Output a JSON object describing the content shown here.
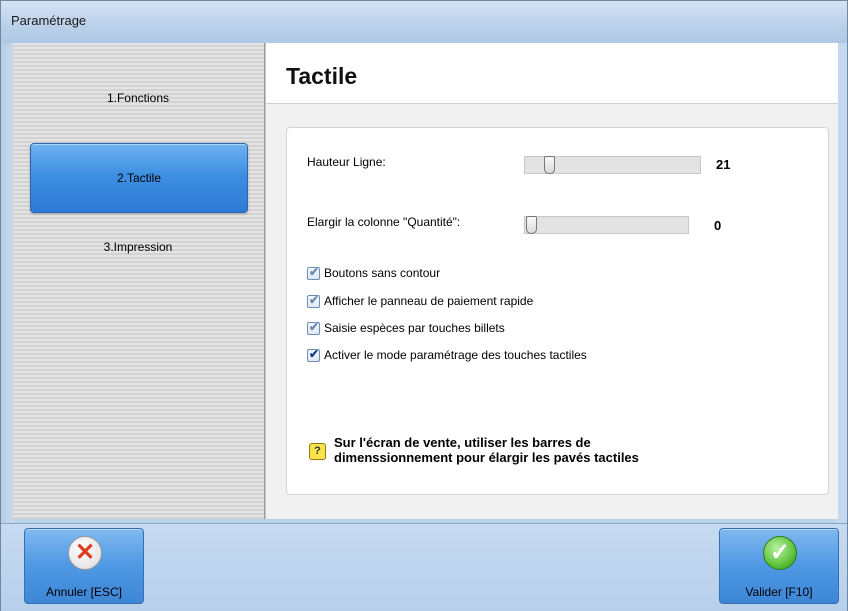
{
  "window": {
    "title": "Paramétrage"
  },
  "sidebar": {
    "items": [
      {
        "label": "1.Fonctions",
        "active": false
      },
      {
        "label": "2.Tactile",
        "active": true
      },
      {
        "label": "3.Impression",
        "active": false
      }
    ]
  },
  "content": {
    "title": "Tactile",
    "hauteur": {
      "label": "Hauteur Ligne:",
      "value": "21"
    },
    "elargir": {
      "label": "Elargir la colonne \"Quantité\":",
      "value": "0"
    },
    "checkboxes": [
      {
        "label": "Boutons sans contour",
        "checked": true
      },
      {
        "label": "Afficher le panneau de paiement rapide",
        "checked": true
      },
      {
        "label": "Saisie espèces par touches billets",
        "checked": true
      },
      {
        "label": "Activer le mode paramétrage des touches tactiles",
        "checked": true
      }
    ],
    "note": {
      "icon": "?",
      "line1": "Sur l'écran de vente, utiliser les barres de",
      "line2": "dimenssionnement pour élargir les pavés tactiles"
    }
  },
  "footer": {
    "cancel_label": "Annuler [ESC]",
    "validate_label": "Valider [F10]",
    "cancel_icon": "✕",
    "validate_icon": "✓"
  },
  "colors": {
    "accent": "#3e8fe2",
    "frame": "#c6daf0"
  }
}
